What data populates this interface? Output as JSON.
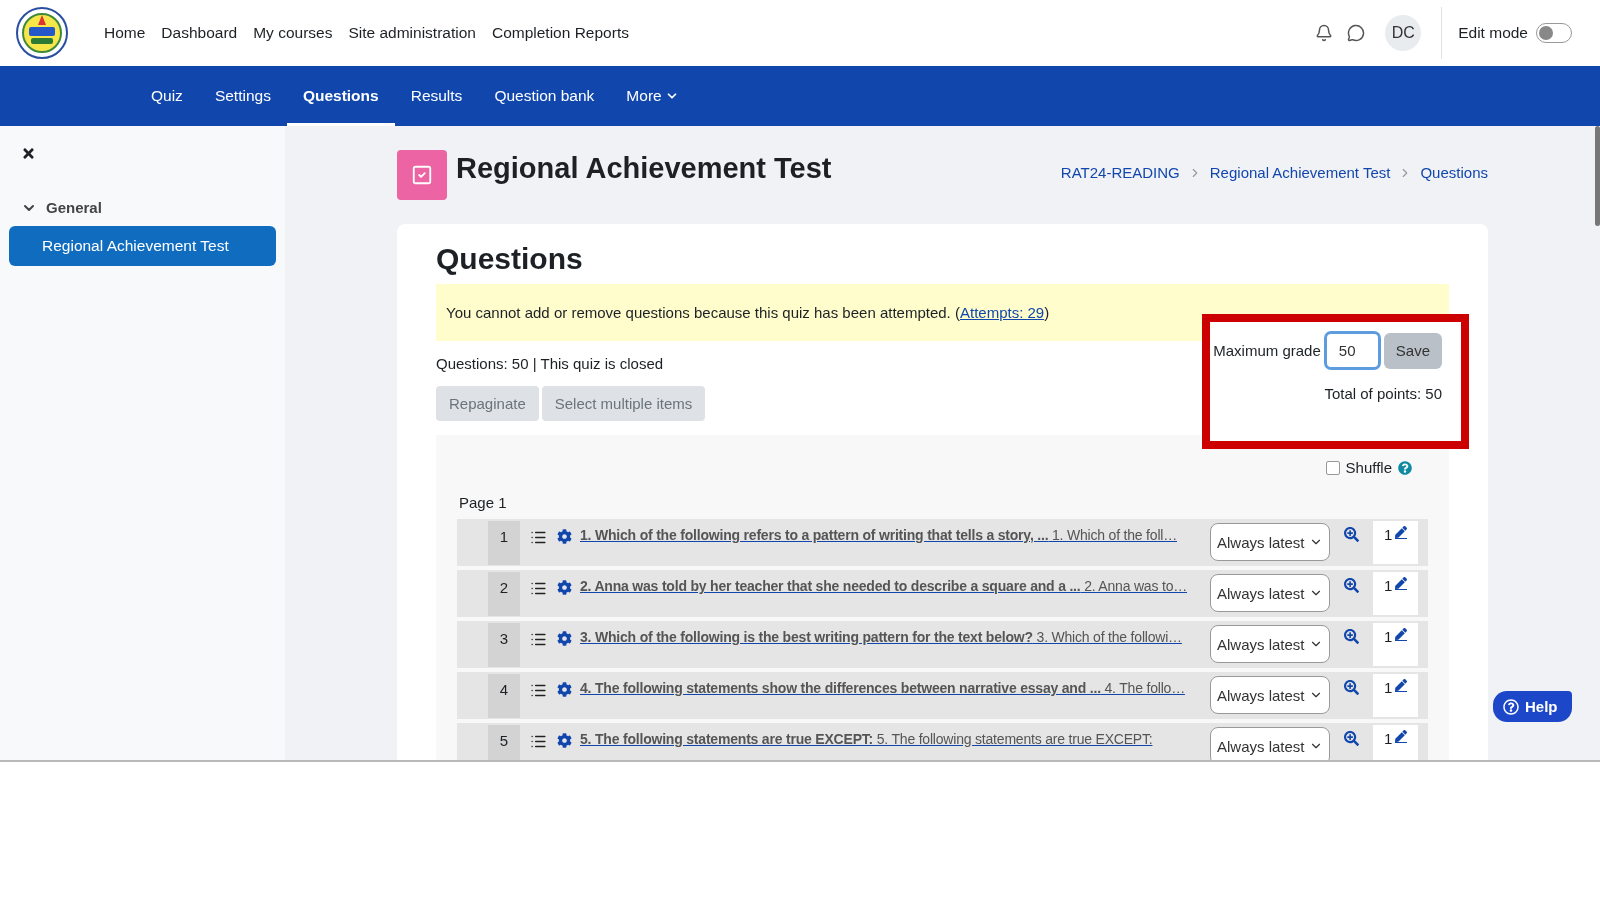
{
  "header": {
    "nav_links": [
      "Home",
      "Dashboard",
      "My courses",
      "Site administration",
      "Completion Reports"
    ],
    "avatar": "DC",
    "edit_mode": {
      "label": "Edit mode",
      "on": false
    }
  },
  "tabs": [
    {
      "label": "Quiz",
      "selected": false,
      "kind": "link"
    },
    {
      "label": "Settings",
      "selected": false,
      "kind": "link"
    },
    {
      "label": "Questions",
      "selected": true,
      "kind": "link"
    },
    {
      "label": "Results",
      "selected": false,
      "kind": "link"
    },
    {
      "label": "Question bank",
      "selected": false,
      "kind": "link"
    },
    {
      "label": "More",
      "selected": false,
      "kind": "menu"
    }
  ],
  "sidebar": {
    "sections": [
      {
        "label": "General",
        "expanded": true,
        "items": [
          {
            "label": "Regional Achievement Test",
            "selected": true
          }
        ]
      }
    ]
  },
  "page_title": "Regional Achievement Test",
  "breadcrumb": [
    "RAT24-READING",
    "Regional Achievement Test",
    "Questions"
  ],
  "card": {
    "heading": "Questions",
    "notice": {
      "text": "You cannot add or remove questions because this quiz has been attempted. (",
      "link": "Attempts: 29",
      "after": ")"
    },
    "summary": "Questions: 50 | This quiz is closed",
    "buttons": [
      "Repaginate",
      "Select multiple items"
    ],
    "grade_box": {
      "highlighted": true,
      "label": "Maximum grade",
      "value": "50",
      "save": "Save",
      "total": "Total of points: 50"
    },
    "shuffle": {
      "label": "Shuffle",
      "checked": false
    },
    "page_label": "Page 1",
    "questions": [
      {
        "number": "1",
        "text": "**1. Which of the following refers to a pattern of writing that tells a story, ...** 1. Which of the foll…",
        "version": "Always latest",
        "mark": "1"
      },
      {
        "number": "2",
        "text": "**2. Anna was told by her teacher that she needed to describe a square and a ...** 2. Anna was to…",
        "version": "Always latest",
        "mark": "1"
      },
      {
        "number": "3",
        "text": "**3. Which of the following is the best writing pattern for the text below?** 3. Which of the followi…",
        "version": "Always latest",
        "mark": "1"
      },
      {
        "number": "4",
        "text": "**4. The following statements show the differences between narrative essay and ...** 4. The follo…",
        "version": "Always latest",
        "mark": "1"
      },
      {
        "number": "5",
        "text": "**5. The following statements are true EXCEPT:** 5. The following statements are true EXCEPT:",
        "version": "Always latest",
        "mark": "1"
      }
    ]
  },
  "help": "Help"
}
